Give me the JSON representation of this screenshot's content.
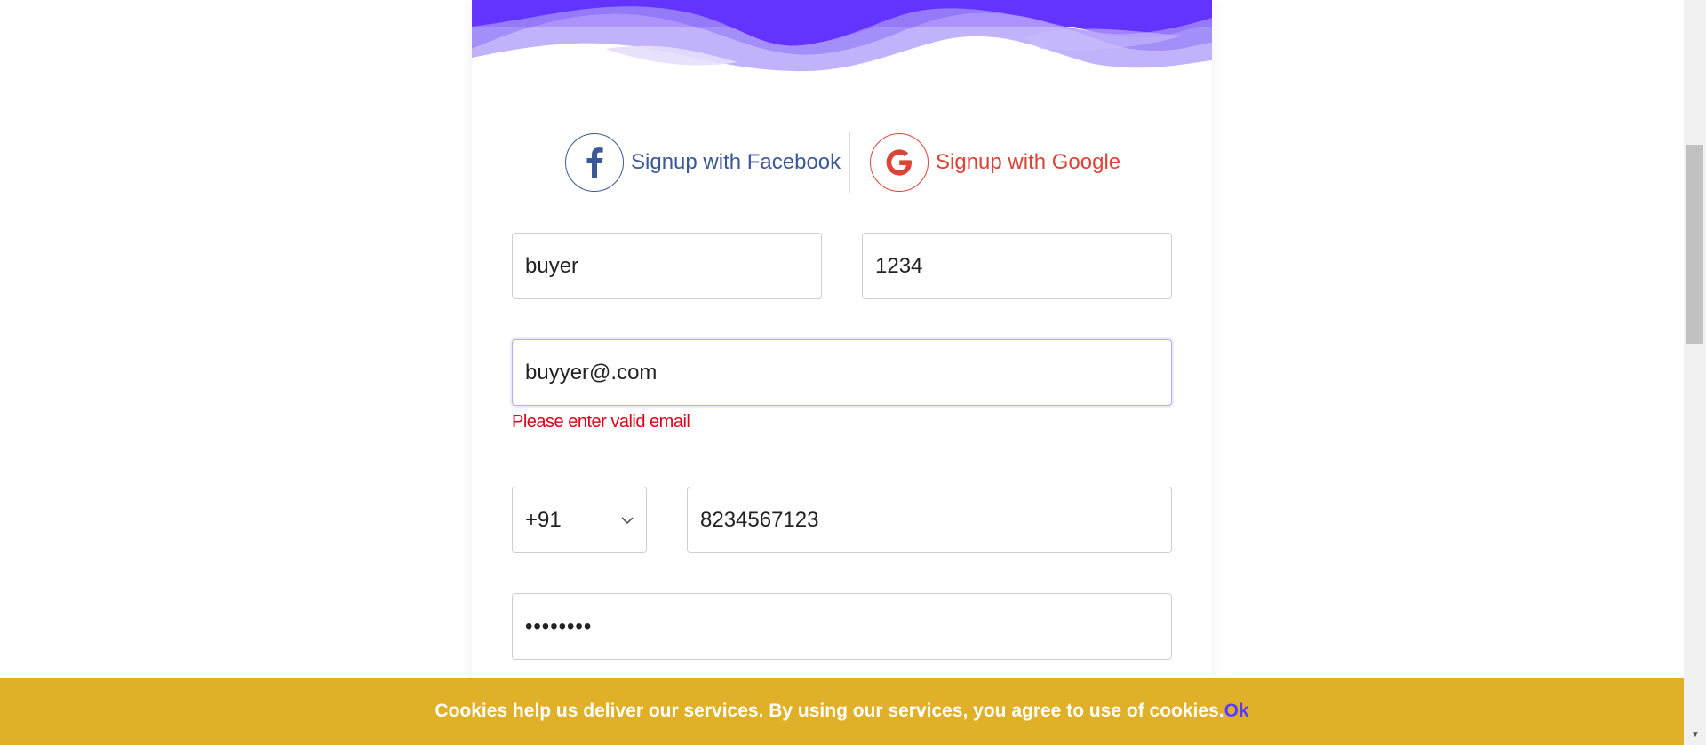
{
  "colors": {
    "wave_primary": "#6333ff",
    "wave_light": "#a48cf8",
    "facebook": "#3b5998",
    "google": "#db4437",
    "error": "#e0001b",
    "cookie_bar": "#e0b028",
    "cookie_ok": "#5a3bff"
  },
  "social": {
    "facebook": {
      "icon": "facebook-icon",
      "label": "Signup with Facebook"
    },
    "google": {
      "icon": "google-icon",
      "label": "Signup with Google"
    }
  },
  "form": {
    "first_field_value": "buyer",
    "second_field_value": "1234",
    "email_value": "buyyer@.com",
    "email_error": "Please enter valid email",
    "country_code_value": "+91",
    "country_code_arrow": "chevron-down-icon",
    "phone_value": "8234567123",
    "password_value": "••••••••"
  },
  "cookie": {
    "message": "Cookies help us deliver our services. By using our services, you agree to use of cookies.",
    "ok_label": "Ok"
  }
}
